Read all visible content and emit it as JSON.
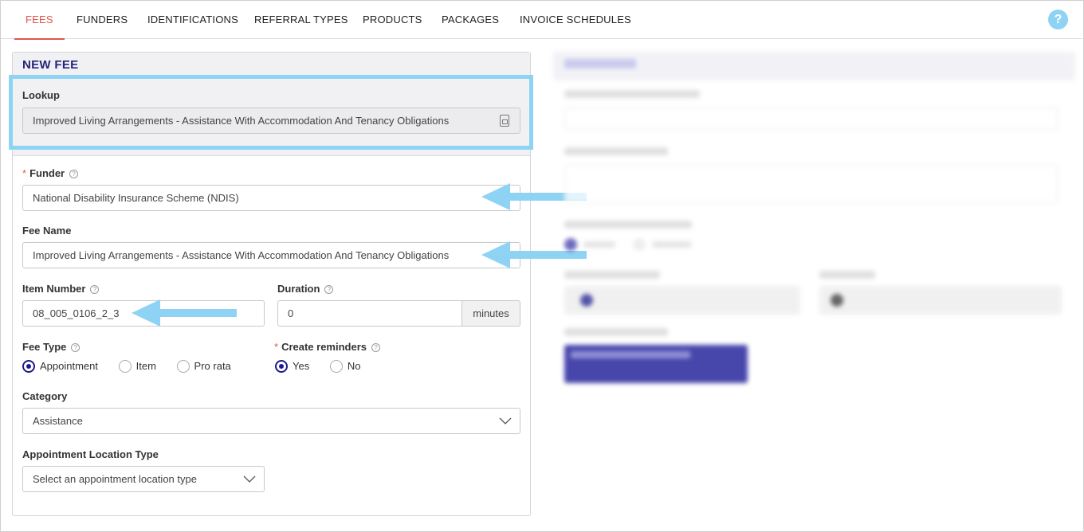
{
  "tabs": [
    {
      "label": "FEES",
      "active": true
    },
    {
      "label": "FUNDERS",
      "active": false
    },
    {
      "label": "IDENTIFICATIONS",
      "active": false
    },
    {
      "label": "REFERRAL TYPES",
      "active": false
    },
    {
      "label": "PRODUCTS",
      "active": false
    },
    {
      "label": "PACKAGES",
      "active": false
    },
    {
      "label": "INVOICE SCHEDULES",
      "active": false
    }
  ],
  "help_icon": "question-circle-icon",
  "help_label": "?",
  "new_fee": {
    "title": "NEW FEE",
    "lookup": {
      "label": "Lookup",
      "value": "Improved Living Arrangements - Assistance With Accommodation And Tenancy Obligations",
      "icon": "lookup-icon"
    },
    "funder": {
      "label": "Funder",
      "required_mark": "*",
      "value": "National Disability Insurance Scheme (NDIS)"
    },
    "fee_name": {
      "label": "Fee Name",
      "value": "Improved Living Arrangements - Assistance With Accommodation And Tenancy Obligations"
    },
    "item_number": {
      "label": "Item Number",
      "value": "08_005_0106_2_3"
    },
    "duration": {
      "label": "Duration",
      "value": "0",
      "unit": "minutes"
    },
    "fee_type": {
      "label": "Fee Type",
      "options": [
        "Appointment",
        "Item",
        "Pro rata"
      ],
      "selected": "Appointment"
    },
    "create_reminders": {
      "label": "Create reminders",
      "required_mark": "*",
      "options": [
        "Yes",
        "No"
      ],
      "selected": "Yes"
    },
    "category": {
      "label": "Category",
      "value": "Assistance"
    },
    "appointment_location_type": {
      "label": "Appointment Location Type",
      "placeholder": "Select an appointment location type"
    }
  },
  "colors": {
    "active_tab": "#e0564f",
    "title": "#24267a",
    "radio_checked": "#1b1a8c",
    "highlight": "#8fd3f4",
    "arrow": "#8fd3f4"
  }
}
